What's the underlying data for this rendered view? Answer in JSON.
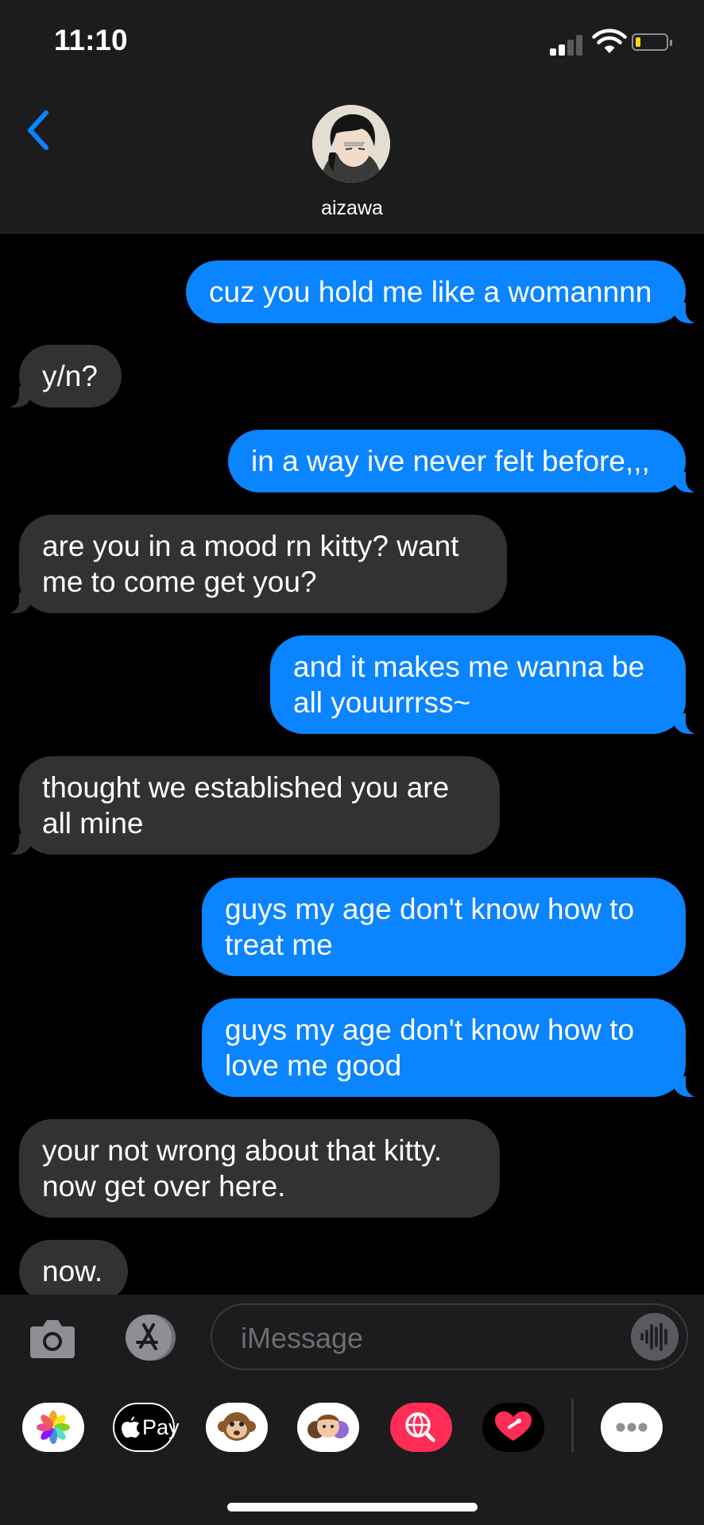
{
  "status_bar": {
    "time": "11:10",
    "battery_level": 0.15,
    "battery_color": "#ffd60a"
  },
  "header": {
    "contact_name": "aizawa",
    "accent": "#0a84ff"
  },
  "messages": [
    {
      "from": "me",
      "text": "cuz you hold me like a womannnn"
    },
    {
      "from": "them",
      "text": "y/n?"
    },
    {
      "from": "me",
      "text": "in a way ive never felt before,,,"
    },
    {
      "from": "them",
      "text": "are you in a mood rn kitty? want me to come get you?"
    },
    {
      "from": "me",
      "text": "and it makes me wanna be all youurrrss~"
    },
    {
      "from": "them",
      "text": "thought we established you are all mine"
    },
    {
      "from": "me",
      "text": "guys my age don't know how to treat me"
    },
    {
      "from": "me",
      "text": "guys my age don't know how to love me good"
    },
    {
      "from": "them",
      "text": "your not wrong about that kitty. now get over here."
    },
    {
      "from": "them",
      "text": "now."
    }
  ],
  "composer": {
    "placeholder": "iMessage",
    "icons": [
      "camera-icon",
      "app-store-icon",
      "audio-waveform-icon"
    ]
  },
  "app_drawer": {
    "items": [
      {
        "name": "photos-app-icon",
        "label": ""
      },
      {
        "name": "apple-pay-app-icon",
        "label": "Pay"
      },
      {
        "name": "animoji-app-icon",
        "label": ""
      },
      {
        "name": "memoji-app-icon",
        "label": ""
      },
      {
        "name": "web-search-app-icon",
        "label": ""
      },
      {
        "name": "digital-touch-app-icon",
        "label": ""
      },
      {
        "name": "more-apps-icon",
        "label": ""
      }
    ]
  },
  "colors": {
    "sent_bubble": "#0a84ff",
    "received_bubble": "#323235",
    "background": "#000000",
    "bar": "#1c1c1e"
  }
}
